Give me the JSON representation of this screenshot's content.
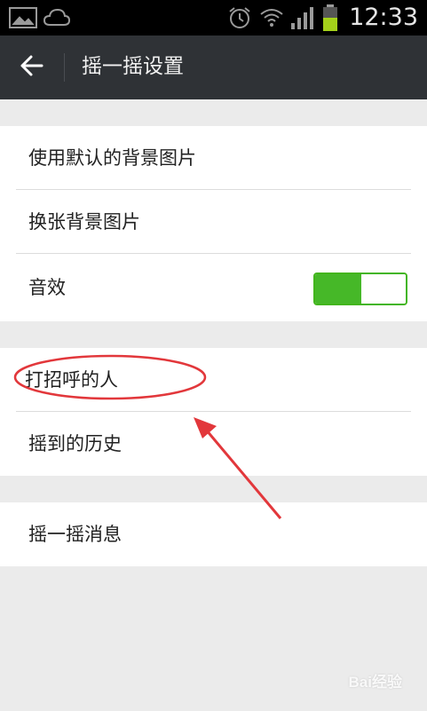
{
  "status_bar": {
    "time": "12:33",
    "icons": [
      "gallery-icon",
      "weather-icon",
      "alarm-icon",
      "wifi-icon",
      "signal-icon",
      "battery-icon"
    ]
  },
  "title_bar": {
    "back_icon": "arrow-left-icon",
    "title": "摇一摇设置"
  },
  "sections": [
    {
      "rows": [
        {
          "label": "使用默认的背景图片"
        },
        {
          "label": "换张背景图片"
        },
        {
          "label": "音效",
          "toggle": {
            "on": true
          }
        }
      ]
    },
    {
      "rows": [
        {
          "label": "打招呼的人"
        },
        {
          "label": "摇到的历史"
        }
      ]
    },
    {
      "rows": [
        {
          "label": "摇一摇消息"
        }
      ]
    }
  ],
  "colors": {
    "status_bar": "#000000",
    "title_bar": "#2f3236",
    "background": "#ebebeb",
    "toggle_on": "#46b828",
    "annotation": "#e2373b"
  },
  "watermark": "Bai经验"
}
